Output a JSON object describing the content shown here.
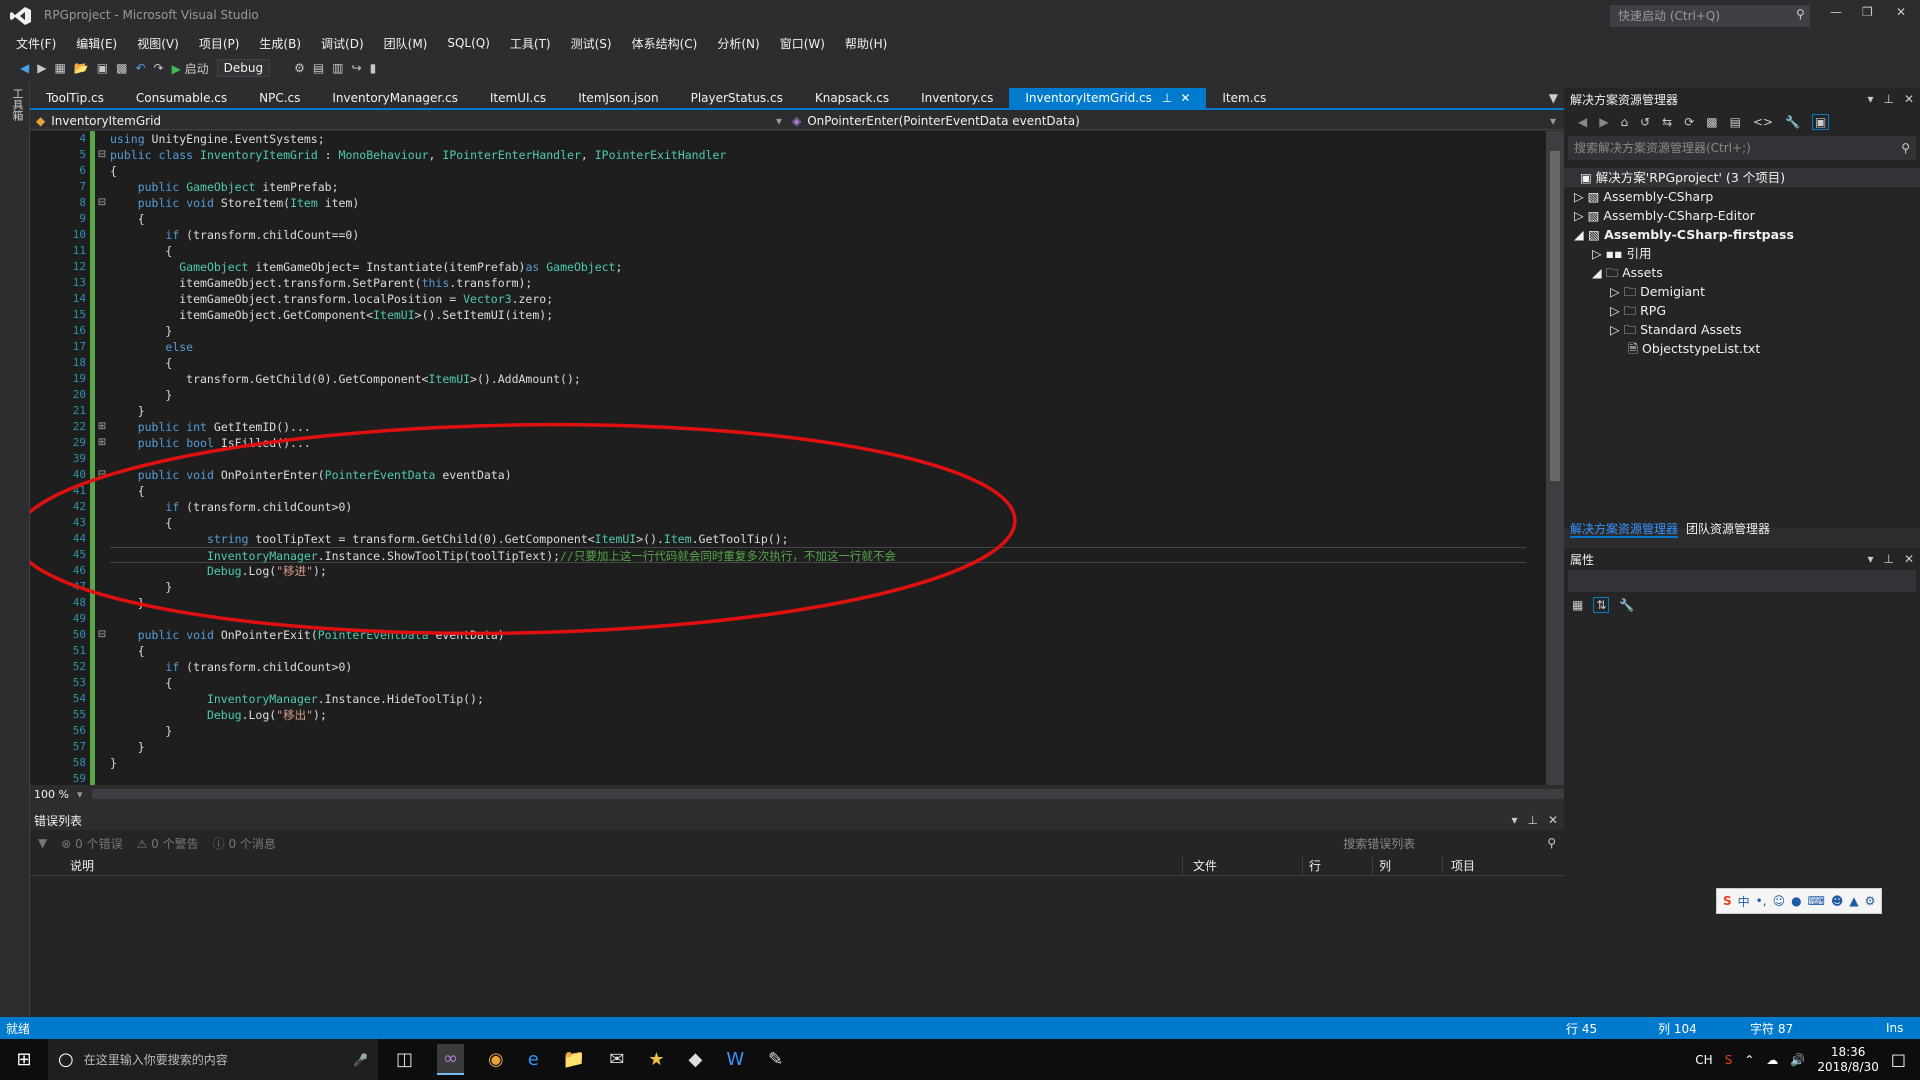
{
  "app": {
    "title": "RPGproject - Microsoft Visual Studio",
    "quick_launch": "快速启动 (Ctrl+Q)"
  },
  "menu": [
    "文件(F)",
    "编辑(E)",
    "视图(V)",
    "项目(P)",
    "生成(B)",
    "调试(D)",
    "团队(M)",
    "SQL(Q)",
    "工具(T)",
    "测试(S)",
    "体系结构(C)",
    "分析(N)",
    "窗口(W)",
    "帮助(H)"
  ],
  "toolbar": {
    "start_label": "启动",
    "config": "Debug"
  },
  "left_tool_label": "工具箱",
  "tabs": [
    "ToolTip.cs",
    "Consumable.cs",
    "NPC.cs",
    "InventoryManager.cs",
    "ItemUI.cs",
    "ItemJson.json",
    "PlayerStatus.cs",
    "Knapsack.cs",
    "Inventory.cs",
    "InventoryItemGrid.cs",
    "Item.cs"
  ],
  "nav": {
    "class": "InventoryItemGrid",
    "member": "OnPointerEnter(PointerEventData eventData)"
  },
  "line_numbers": [
    "4",
    "5",
    "6",
    "7",
    "8",
    "9",
    "10",
    "11",
    "12",
    "13",
    "14",
    "15",
    "16",
    "17",
    "18",
    "19",
    "20",
    "21",
    "22",
    "29",
    "39",
    "40",
    "41",
    "42",
    "43",
    "44",
    "45",
    "46",
    "47",
    "48",
    "49",
    "50",
    "51",
    "52",
    "53",
    "54",
    "55",
    "56",
    "57",
    "58",
    "59"
  ],
  "code": [
    "using UnityEngine.EventSystems;",
    "public class InventoryItemGrid : MonoBehaviour, IPointerEnterHandler, IPointerExitHandler",
    "{",
    "    public GameObject itemPrefab;",
    "    public void StoreItem(Item item)",
    "    {",
    "        if (transform.childCount==0)",
    "        {",
    "          GameObject itemGameObject= Instantiate(itemPrefab)as GameObject;",
    "          itemGameObject.transform.SetParent(this.transform);",
    "          itemGameObject.transform.localPosition = Vector3.zero;",
    "          itemGameObject.GetComponent<ItemUI>().SetItemUI(item);",
    "        }",
    "        else",
    "        {",
    "           transform.GetChild(0).GetComponent<ItemUI>().AddAmount();",
    "        }",
    "    }",
    "    public int GetItemID()...",
    "    public bool IsFilled()...",
    "",
    "    public void OnPointerEnter(PointerEventData eventData)",
    "    {",
    "        if (transform.childCount>0)",
    "        {",
    "              string toolTipText = transform.GetChild(0).GetComponent<ItemUI>().Item.GetToolTip();",
    "              InventoryManager.Instance.ShowToolTip(toolTipText);//只要加上这一行代码就会同时重复多次执行，不加这一行就不会",
    "              Debug.Log(\"移进\");",
    "        }",
    "    }",
    "",
    "    public void OnPointerExit(PointerEventData eventData)",
    "    {",
    "        if (transform.childCount>0)",
    "        {",
    "              InventoryManager.Instance.HideToolTip();",
    "              Debug.Log(\"移出\");",
    "        }",
    "    }",
    "}",
    ""
  ],
  "zoom": "100 %",
  "error_list": {
    "title": "错误列表",
    "errors": "0 个错误",
    "warnings": "0 个警告",
    "messages": "0 个消息",
    "search": "搜索错误列表",
    "columns": [
      "说明",
      "文件",
      "行",
      "列",
      "项目"
    ]
  },
  "solution_explorer": {
    "title": "解决方案资源管理器",
    "search": "搜索解决方案资源管理器(Ctrl+;)",
    "items": [
      "解决方案'RPGproject' (3 个项目)",
      "Assembly-CSharp",
      "Assembly-CSharp-Editor",
      "Assembly-CSharp-firstpass",
      "引用",
      "Assets",
      "Demigiant",
      "RPG",
      "Standard Assets",
      "ObjectstypeList.txt"
    ],
    "bottom_tabs": [
      "解决方案资源管理器",
      "团队资源管理器"
    ]
  },
  "properties": {
    "title": "属性"
  },
  "status": {
    "ready": "就绪",
    "line": "行 45",
    "col": "列 104",
    "char": "字符 87",
    "mode": "Ins"
  },
  "taskbar": {
    "search": "在这里输入你要搜索的内容",
    "lang": "CH",
    "time": "18:36",
    "date": "2018/8/30"
  },
  "colors": {
    "accent": "#007acc",
    "annotation": "#e01010"
  }
}
